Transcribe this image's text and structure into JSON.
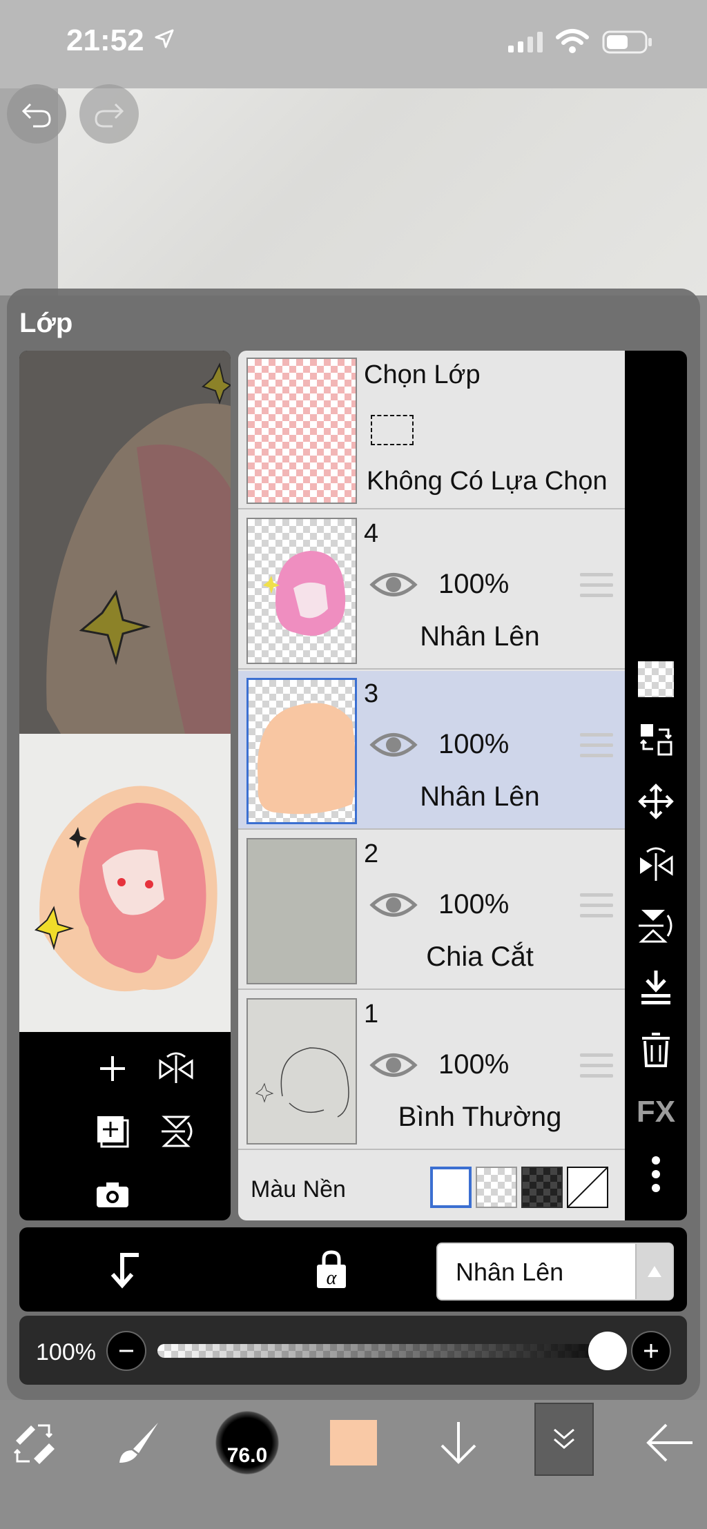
{
  "status": {
    "time": "21:52"
  },
  "panel": {
    "title": "Lớp"
  },
  "selection_layer": {
    "title": "Chọn Lớp",
    "status": "Không Có Lựa Chọn"
  },
  "layers": [
    {
      "number": "4",
      "opacity": "100%",
      "blend": "Nhân Lên",
      "selected": false
    },
    {
      "number": "3",
      "opacity": "100%",
      "blend": "Nhân Lên",
      "selected": true
    },
    {
      "number": "2",
      "opacity": "100%",
      "blend": "Chia Cắt",
      "selected": false
    },
    {
      "number": "1",
      "opacity": "100%",
      "blend": "Bình Thường",
      "selected": false
    }
  ],
  "background": {
    "label": "Màu Nền"
  },
  "right_tools": {
    "fx_label": "FX"
  },
  "blend_select": {
    "value": "Nhân Lên"
  },
  "opacity_slider": {
    "label": "100%",
    "value": 1.0
  },
  "toolbar": {
    "brush_size": "76.0",
    "color": "#f9c9a6"
  },
  "colors": {
    "selected_row": "#cfd6ea",
    "selected_border": "#3b6fd1",
    "accent": "#3b6fd1"
  }
}
